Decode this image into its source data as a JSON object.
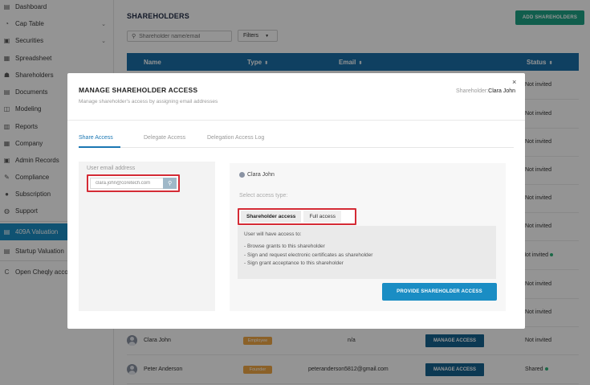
{
  "sidebar": {
    "items": [
      {
        "label": "Dashboard",
        "icon": "dashboard-icon",
        "glyph": "▤",
        "chevron": false
      },
      {
        "label": "Cap Table",
        "icon": "cap-table-icon",
        "glyph": "◔",
        "chevron": true
      },
      {
        "label": "Securities",
        "icon": "securities-icon",
        "glyph": "▣",
        "chevron": true
      },
      {
        "label": "Spreadsheet",
        "icon": "spreadsheet-icon",
        "glyph": "▦",
        "chevron": false
      },
      {
        "label": "Shareholders",
        "icon": "shareholders-icon",
        "glyph": "☗",
        "chevron": false
      },
      {
        "label": "Documents",
        "icon": "documents-icon",
        "glyph": "▤",
        "chevron": false
      },
      {
        "label": "Modeling",
        "icon": "modeling-icon",
        "glyph": "◫",
        "chevron": false
      },
      {
        "label": "Reports",
        "icon": "reports-icon",
        "glyph": "▥",
        "chevron": false
      },
      {
        "label": "Company",
        "icon": "company-icon",
        "glyph": "▦",
        "chevron": false
      },
      {
        "label": "Admin Records",
        "icon": "admin-records-icon",
        "glyph": "▣",
        "chevron": false
      },
      {
        "label": "Compliance",
        "icon": "compliance-icon",
        "glyph": "✎",
        "chevron": false
      },
      {
        "label": "Subscription",
        "icon": "subscription-icon",
        "glyph": "●",
        "chevron": false
      },
      {
        "label": "Support",
        "icon": "support-icon",
        "glyph": "◍",
        "chevron": false
      },
      {
        "label": "409A Valuation",
        "icon": "valuation-icon",
        "glyph": "▤",
        "chevron": false,
        "active": true
      },
      {
        "label": "Startup Valuation",
        "icon": "startup-valuation-icon",
        "glyph": "▤",
        "chevron": false
      },
      {
        "label": "Open Cheqly acco",
        "icon": "cheqly-logo-icon",
        "glyph": "C",
        "chevron": false
      }
    ]
  },
  "header": {
    "title": "SHAREHOLDERS",
    "add_button": "ADD SHAREHOLDERS",
    "search_placeholder": "Shareholder name/email",
    "filters_label": "Filters"
  },
  "table": {
    "columns": [
      "Name",
      "Type",
      "Email",
      "Status"
    ],
    "sort_glyph": "⬍",
    "status_column": [
      "Not invited",
      "Not invited",
      "Not invited",
      "Not invited",
      "Not invited",
      "Not invited",
      "Not invited",
      "Not invited",
      "Not invited"
    ],
    "rows": [
      {
        "name": "Clara John",
        "type": "Employee",
        "email": "n/a",
        "action": "MANAGE ACCESS",
        "status": "Not invited"
      },
      {
        "name": "Peter Anderson",
        "type": "Founder",
        "email": "peteranderson5812@gmail.com",
        "action": "MANAGE ACCESS",
        "status": "Shared"
      }
    ]
  },
  "modal": {
    "title": "MANAGE SHAREHOLDER ACCESS",
    "subtitle": "Manage shareholder's access by assigning email addresses",
    "shareholder_label": "Shareholder:",
    "shareholder_name": "Clara John",
    "close_glyph": "×",
    "tabs": [
      "Share Access",
      "Delegate Access",
      "Delegation Access Log"
    ],
    "email_label": "User email address",
    "email_value": "clara.john@coretech.com",
    "user_name": "Clara John",
    "select_label": "Select access type:",
    "access_types": [
      "Shareholder access",
      "Full access"
    ],
    "info_intro": "User will have access to:",
    "info_items": [
      "Browse grants to this shareholder",
      "Sign and request electronic certificates as shareholder",
      "Sign grant acceptance to this shareholder"
    ],
    "provide_button": "PROVIDE SHAREHOLDER ACCESS"
  },
  "colors": {
    "sidebar_active": "#1b8ec4",
    "table_header": "#1a6fa8",
    "add_button": "#1ea386",
    "highlight_border": "#d42b35",
    "primary_button": "#1a8dc4"
  }
}
